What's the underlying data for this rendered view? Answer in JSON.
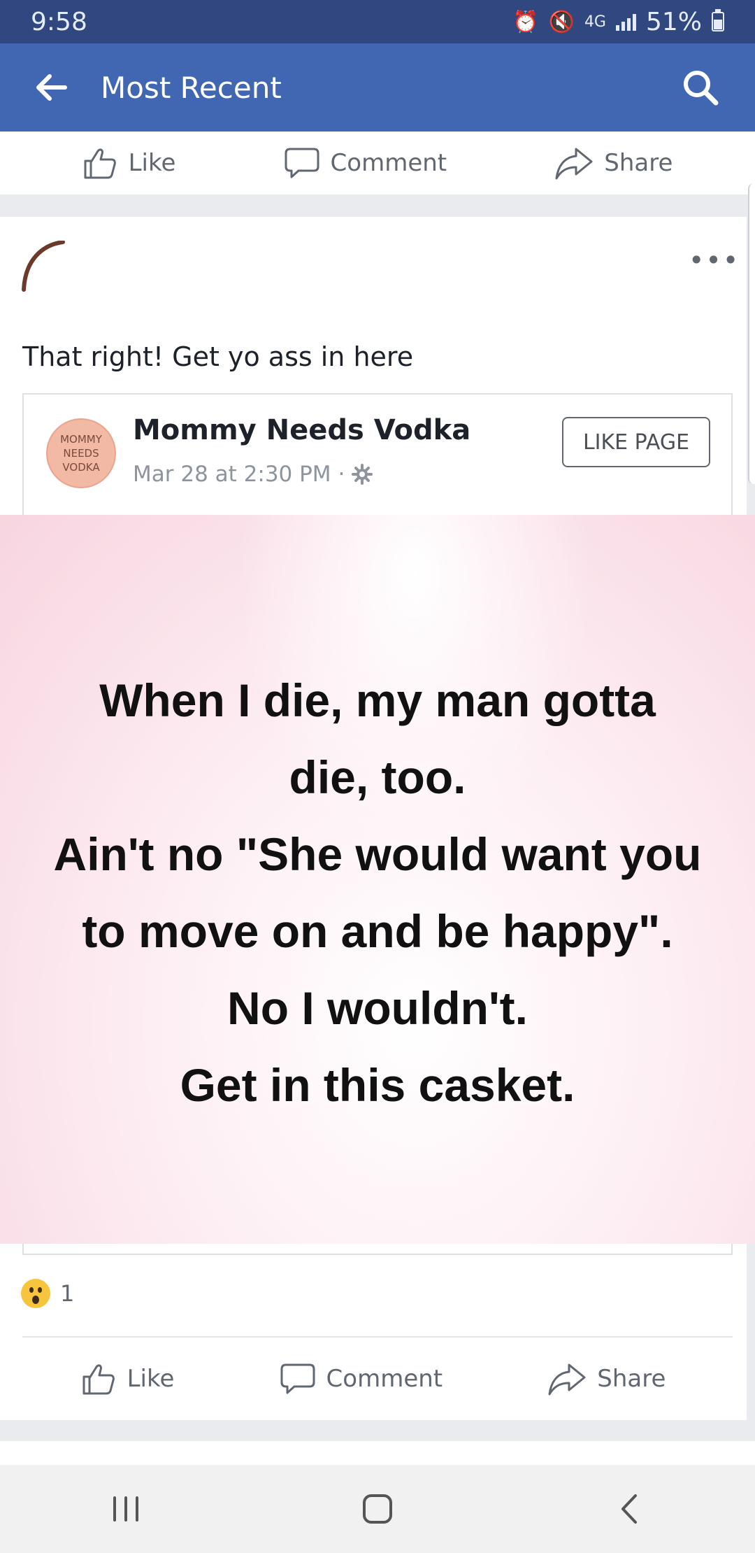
{
  "status_bar": {
    "time": "9:58",
    "network": "4G",
    "battery": "51%"
  },
  "app_bar": {
    "title": "Most Recent"
  },
  "actions": {
    "like": "Like",
    "comment": "Comment",
    "share": "Share"
  },
  "post": {
    "more": "•••",
    "text": "That right! Get yo ass in here",
    "shared": {
      "page_avatar_lines": [
        "MOMMY",
        "NEEDS",
        "VODKA"
      ],
      "page_name": "Mommy Needs Vodka",
      "timestamp": "Mar 28 at 2:30 PM",
      "separator": "·",
      "like_page": "LIKE PAGE",
      "image_text_lines": [
        "When I die, my man gotta",
        "die, too.",
        "Ain't no \"She would want you",
        "to move on and be happy\".",
        "No I wouldn't.",
        "Get in this casket."
      ]
    },
    "reactions": {
      "emoji": "wow-emoji",
      "count": "1"
    }
  },
  "colors": {
    "header": "#4267b2",
    "status": "#30487f"
  }
}
